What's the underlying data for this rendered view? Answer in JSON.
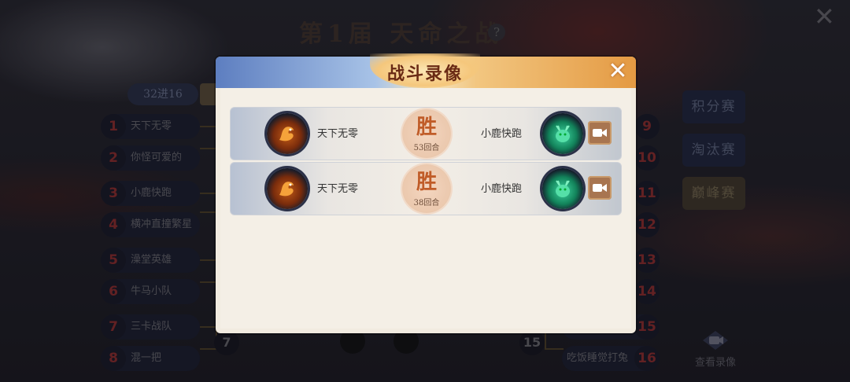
{
  "background": {
    "title": "第1届 天命之战",
    "help_icon": "?",
    "close_icon": "✕",
    "round_tab": "32进16",
    "left_players": [
      {
        "seed": "1",
        "name": "天下无零"
      },
      {
        "seed": "2",
        "name": "你怪可爱的"
      },
      {
        "seed": "3",
        "name": "小鹿快跑"
      },
      {
        "seed": "4",
        "name": "横冲直撞繁星"
      },
      {
        "seed": "5",
        "name": "澡堂英雄"
      },
      {
        "seed": "6",
        "name": "牛马小队"
      },
      {
        "seed": "7",
        "name": "三卡战队"
      },
      {
        "seed": "8",
        "name": "混一把"
      }
    ],
    "right_players": [
      {
        "seed": "9",
        "name": ""
      },
      {
        "seed": "10",
        "name": ""
      },
      {
        "seed": "11",
        "name": ""
      },
      {
        "seed": "12",
        "name": ""
      },
      {
        "seed": "13",
        "name": ""
      },
      {
        "seed": "14",
        "name": ""
      },
      {
        "seed": "15",
        "name": ""
      },
      {
        "seed": "16",
        "name": "吃饭睡觉打兔"
      }
    ],
    "bracket_seeds": {
      "left": "7",
      "right": "15"
    },
    "side_tabs": [
      {
        "label": "积分赛",
        "active": false
      },
      {
        "label": "淘汰赛",
        "active": false
      },
      {
        "label": "巅峰赛",
        "active": true
      }
    ],
    "view_replay_label": "查看录像"
  },
  "modal": {
    "title": "战斗录像",
    "close_icon": "✕",
    "records": [
      {
        "left_player": "天下无零",
        "left_icon": "fire-dragon-icon",
        "result": "胜",
        "rounds": "53回合",
        "right_player": "小鹿快跑",
        "right_icon": "jade-deer-icon",
        "play_icon": "video-camera-icon"
      },
      {
        "left_player": "天下无零",
        "left_icon": "fire-dragon-icon",
        "result": "胜",
        "rounds": "38回合",
        "right_player": "小鹿快跑",
        "right_icon": "jade-deer-icon",
        "play_icon": "video-camera-icon"
      }
    ]
  },
  "colors": {
    "modal_bg": "#f1ebe0",
    "win_text": "#c05c28",
    "header_left": "#5d7ec0",
    "header_right": "#e49a43",
    "seed_red": "#aa3333"
  }
}
